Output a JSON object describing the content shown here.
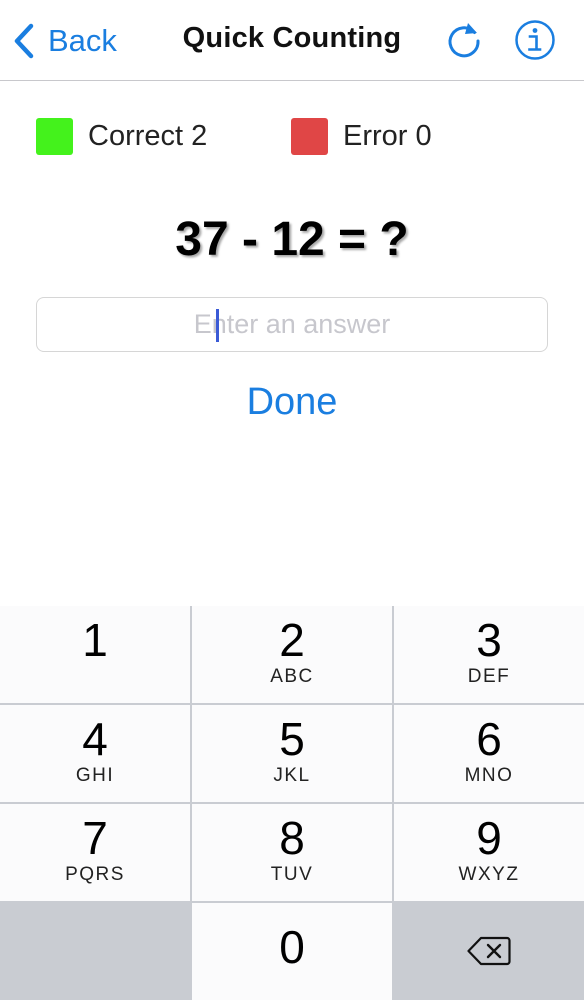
{
  "nav": {
    "back_label": "Back",
    "title": "Quick Counting",
    "refresh_icon": "refresh-icon",
    "info_icon": "info-icon"
  },
  "score": {
    "correct_label": "Correct",
    "correct_value": "2",
    "correct_color": "#44f21c",
    "error_label": "Error",
    "error_value": "0",
    "error_color": "#e04646"
  },
  "question": {
    "text": "37 - 12 = ?"
  },
  "answer": {
    "value": "",
    "placeholder": "Enter an answer"
  },
  "done_label": "Done",
  "keypad": {
    "keys": [
      {
        "digit": "1",
        "letters": ""
      },
      {
        "digit": "2",
        "letters": "ABC"
      },
      {
        "digit": "3",
        "letters": "DEF"
      },
      {
        "digit": "4",
        "letters": "GHI"
      },
      {
        "digit": "5",
        "letters": "JKL"
      },
      {
        "digit": "6",
        "letters": "MNO"
      },
      {
        "digit": "7",
        "letters": "PQRS"
      },
      {
        "digit": "8",
        "letters": "TUV"
      },
      {
        "digit": "9",
        "letters": "WXYZ"
      },
      {
        "digit": "0",
        "letters": ""
      }
    ],
    "backspace_icon": "backspace-icon"
  },
  "colors": {
    "accent": "#1a7ee0",
    "keypad_background": "#c9ccd2",
    "key_background": "#fbfbfc"
  }
}
